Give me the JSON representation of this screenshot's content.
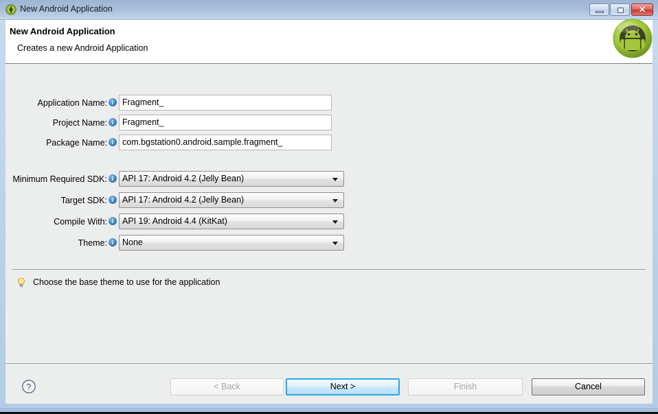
{
  "window": {
    "title": "New Android Application",
    "icon": "android-round-icon",
    "controls": {
      "minimize": "minimize-icon",
      "maximize": "maximize-icon",
      "close": "✕"
    }
  },
  "banner": {
    "title": "New Android Application",
    "subtitle": "Creates a new Android Application",
    "logo": "android-robot-logo"
  },
  "form": {
    "text_fields": [
      {
        "label": "Application Name:",
        "value": "Fragment_",
        "info": "info-icon"
      },
      {
        "label": "Project Name:",
        "value": "Fragment_",
        "info": "info-icon"
      },
      {
        "label": "Package Name:",
        "value": "com.bgstation0.android.sample.fragment_",
        "info": "info-icon"
      }
    ],
    "combos": [
      {
        "label": "Minimum Required SDK:",
        "value": "API 17: Android 4.2 (Jelly Bean)",
        "info": "info-icon"
      },
      {
        "label": "Target SDK:",
        "value": "API 17: Android 4.2 (Jelly Bean)",
        "info": "info-icon"
      },
      {
        "label": "Compile With:",
        "value": "API 19: Android 4.4 (KitKat)",
        "info": "info-icon"
      },
      {
        "label": "Theme:",
        "value": "None",
        "info": "info-icon"
      }
    ]
  },
  "hint": {
    "icon": "lightbulb-icon",
    "text": "Choose the base theme to use for the application"
  },
  "buttons": {
    "help": "?",
    "back": "< Back",
    "next": "Next >",
    "finish": "Finish",
    "cancel": "Cancel"
  },
  "colors": {
    "titlebar_top": "#9db4d2",
    "titlebar_bottom": "#c5d7ec",
    "dialog_bg": "#eceded",
    "default_button_border": "#2aa8e8",
    "close_button": "#c93b33",
    "android_green": "#a4c639",
    "info_icon_blue": "#3f82c4"
  }
}
